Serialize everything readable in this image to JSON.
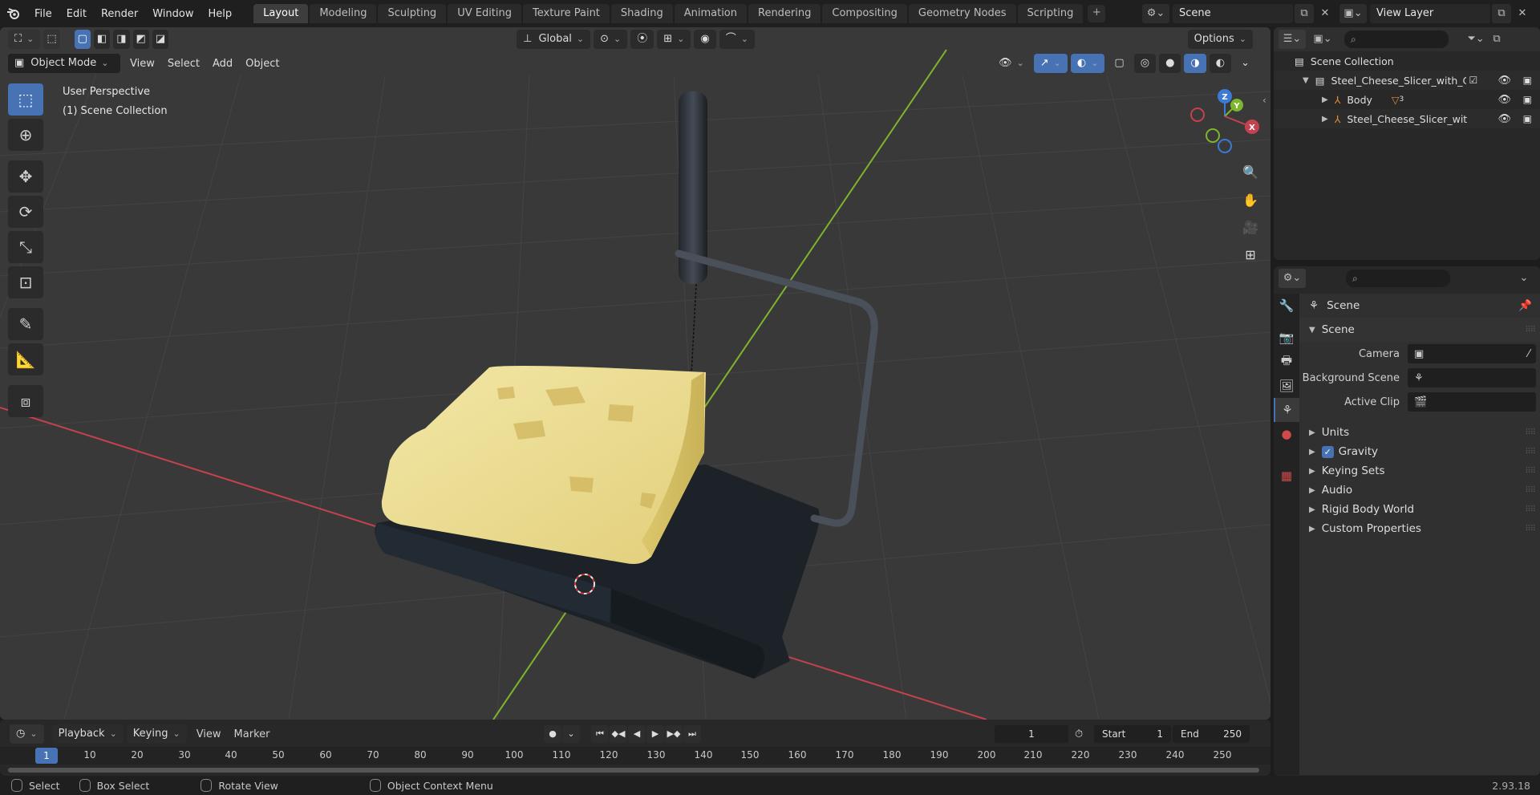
{
  "topbar": {
    "menus": [
      "File",
      "Edit",
      "Render",
      "Window",
      "Help"
    ],
    "workspaces": [
      "Layout",
      "Modeling",
      "Sculpting",
      "UV Editing",
      "Texture Paint",
      "Shading",
      "Animation",
      "Rendering",
      "Compositing",
      "Geometry Nodes",
      "Scripting"
    ],
    "active_workspace": "Layout",
    "scene": "Scene",
    "view_layer": "View Layer"
  },
  "viewport": {
    "transform_orientation": "Global",
    "options_label": "Options",
    "mode": "Object Mode",
    "menus": [
      "View",
      "Select",
      "Add",
      "Object"
    ],
    "perspective_label": "User Perspective",
    "collection_label": "(1) Scene Collection",
    "gizmo_axes": {
      "x": "X",
      "y": "Y",
      "z": "Z"
    },
    "colors": {
      "x_axis": "#c4424f",
      "y_axis": "#7db52c",
      "z_axis": "#3b7bd6",
      "cheese": "#e9d98a",
      "metal": "#3a3f47",
      "accent": "#4772b3"
    }
  },
  "outliner": {
    "root": "Scene Collection",
    "items": [
      {
        "label": "Steel_Cheese_Slicer_with_Che",
        "type": "collection"
      },
      {
        "label": "Body",
        "type": "object",
        "badge": "3"
      },
      {
        "label": "Steel_Cheese_Slicer_with",
        "type": "object"
      }
    ]
  },
  "properties": {
    "context": "Scene",
    "panel": "Scene",
    "fields": [
      {
        "label": "Camera",
        "value": ""
      },
      {
        "label": "Background Scene",
        "value": ""
      },
      {
        "label": "Active Clip",
        "value": ""
      }
    ],
    "sections": [
      "Units",
      "Gravity",
      "Keying Sets",
      "Audio",
      "Rigid Body World",
      "Custom Properties"
    ],
    "gravity_checked": true
  },
  "timeline": {
    "menus": [
      "Playback",
      "Keying",
      "View",
      "Marker"
    ],
    "current_frame": "1",
    "start_label": "Start",
    "start": "1",
    "end_label": "End",
    "end": "250",
    "ruler_current": "1",
    "ruler_ticks": [
      "10",
      "20",
      "30",
      "40",
      "50",
      "60",
      "70",
      "80",
      "90",
      "100",
      "110",
      "120",
      "130",
      "140",
      "150",
      "160",
      "170",
      "180",
      "190",
      "200",
      "210",
      "220",
      "230",
      "240",
      "250"
    ]
  },
  "statusbar": {
    "select": "Select",
    "box_select": "Box Select",
    "rotate_view": "Rotate View",
    "context_menu": "Object Context Menu",
    "version": "2.93.18"
  }
}
